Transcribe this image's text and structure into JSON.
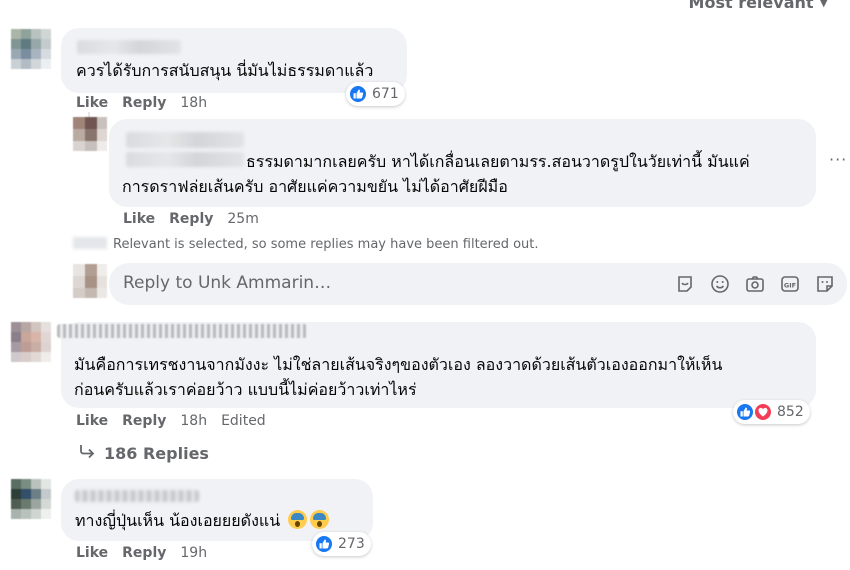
{
  "sort": {
    "label": "Most relevant",
    "icon": "chevron-down-icon"
  },
  "comments": [
    {
      "text_lines": [
        "ควรได้รับการสนับสนุน นี่มันไม่ธรรมดาแล้ว"
      ],
      "like_label": "Like",
      "reply_label": "Reply",
      "time": "18h",
      "reaction_count": "671",
      "reactions": [
        "like"
      ]
    },
    {
      "text_lines": [
        "ธรรมดามากเลยครับ หาได้เกลื่อนเลยตามรร.สอนวาดรูปในวัยเท่านี้ มันแค่",
        "การดราฟล่ยเส้นครับ อาศัยแค่ความขยัน ไม่ได้อาศัยฝีมือ"
      ],
      "like_label": "Like",
      "reply_label": "Reply",
      "time": "25m",
      "more_label": "···"
    },
    {
      "text_lines": [
        "มันคือการเทรชงานจากมังงะ ไม่ใช่ลายเส้นจริงๆของตัวเอง ลองวาดด้วยเส้นตัวเองออกมาให้เห็น",
        "ก่อนครับแล้วเราค่อยว้าว แบบนี้ไม่ค่อยว้าวเท่าไหร่"
      ],
      "like_label": "Like",
      "reply_label": "Reply",
      "time": "18h",
      "edited_label": "Edited",
      "reaction_count": "852",
      "reactions": [
        "like",
        "love"
      ]
    },
    {
      "text_lines": [
        "ทางญี่ปุ่นเห็น น้องเอยยยดังแน่"
      ],
      "like_label": "Like",
      "reply_label": "Reply",
      "time": "19h",
      "reaction_count": "273",
      "reactions": [
        "like"
      ]
    }
  ],
  "filter_note": "Relevant is selected, so some replies may have been filtered out.",
  "reply_box": {
    "placeholder": "Reply to Unk Ammarin…",
    "tools": [
      "sticker-icon",
      "emoji-icon",
      "camera-icon",
      "gif-icon",
      "sticker-face-icon"
    ]
  },
  "view_replies": {
    "label": "186 Replies",
    "icon": "reply-arrow-icon"
  },
  "colors": {
    "like": "#1877f2",
    "love": "#f33e58",
    "bubble": "#f0f2f5",
    "meta": "#65676b"
  }
}
